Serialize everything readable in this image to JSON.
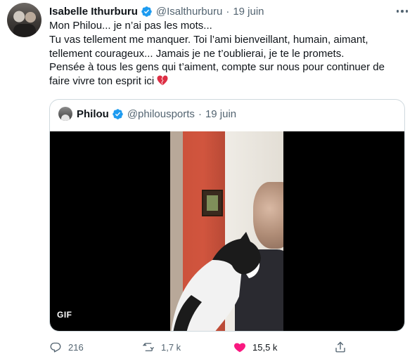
{
  "author": {
    "display_name": "Isabelle Ithurburu",
    "handle": "@Isalthurburu",
    "separator": "·",
    "date": "19 juin",
    "verified": true
  },
  "tweet_text": {
    "lines": [
      "Mon Philou... je n’ai pas les mots...",
      "Tu vas tellement me manquer. Toi l’ami bienveillant, humain, aimant,",
      "tellement courageux... Jamais je ne t’oublierai, je te le promets.",
      "Pensée à tous les gens qui t’aiment, compte sur nous pour continuer de",
      "faire vivre ton esprit ici"
    ],
    "trailing_emoji": "broken-heart-emoji"
  },
  "quoted_tweet": {
    "display_name": "Philou",
    "handle": "@philousports",
    "separator": "·",
    "date": "19 juin",
    "verified": true,
    "media_badge": "GIF"
  },
  "actions": {
    "reply_count": "216",
    "retweet_count": "1,7 k",
    "like_count": "15,5 k",
    "like_active": true
  },
  "colors": {
    "verified_blue": "#1d9bf0",
    "like_red": "#f91880",
    "secondary_text": "#536471",
    "border": "#cfd9de"
  },
  "icons": [
    "verified-badge-icon",
    "more-icon",
    "reply-icon",
    "retweet-icon",
    "like-icon",
    "share-icon"
  ]
}
